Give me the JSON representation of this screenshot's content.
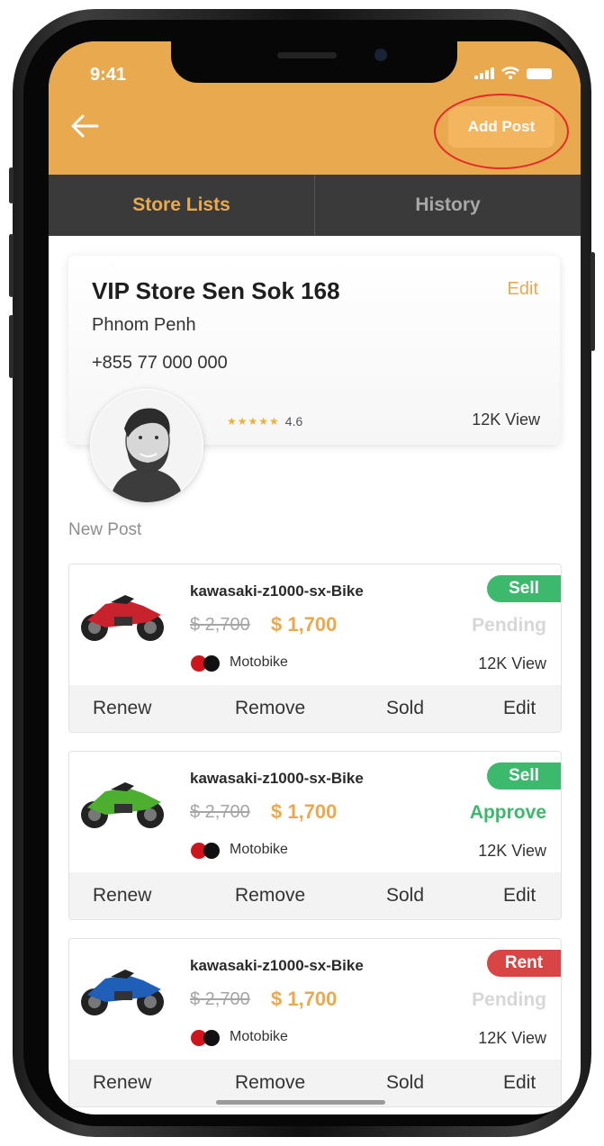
{
  "status_bar": {
    "time": "9:41"
  },
  "header": {
    "add_post_label": "Add Post"
  },
  "tabs": [
    {
      "label": "Store Lists",
      "active": true
    },
    {
      "label": "History",
      "active": false
    }
  ],
  "store": {
    "name": "VIP Store Sen Sok  168",
    "edit_label": "Edit",
    "city": "Phnom Penh",
    "phone": "+855 77 000 000",
    "rating": "4.6",
    "stars": "★★★★★",
    "views": "12K View"
  },
  "section_title": "New Post",
  "posts": [
    {
      "title": "kawasaki-z1000-sx-Bike",
      "old_price": "$ 2,700",
      "new_price": "$ 1,700",
      "category": "Motobike",
      "badge": "Sell",
      "status": "Pending",
      "views": "12K View",
      "bike_color": "#c8222c"
    },
    {
      "title": "kawasaki-z1000-sx-Bike",
      "old_price": "$ 2,700",
      "new_price": "$ 1,700",
      "category": "Motobike",
      "badge": "Sell",
      "status": "Approve",
      "views": "12K View",
      "bike_color": "#4caf2f"
    },
    {
      "title": "kawasaki-z1000-sx-Bike",
      "old_price": "$ 2,700",
      "new_price": "$ 1,700",
      "category": "Motobike",
      "badge": "Rent",
      "status": "Pending",
      "views": "12K View",
      "bike_color": "#1f5fb8"
    }
  ],
  "actions": {
    "renew": "Renew",
    "remove": "Remove",
    "sold": "Sold",
    "edit": "Edit"
  },
  "colors": {
    "accent": "#e9aa4f",
    "tab_bar": "#3a3a3a",
    "sell": "#3cb96c",
    "rent": "#d94545",
    "highlight_ring": "#e32b2b"
  },
  "icons": {
    "back": "arrow-left-icon",
    "avatar": "avatar-icon",
    "category": "motobike-icon"
  }
}
